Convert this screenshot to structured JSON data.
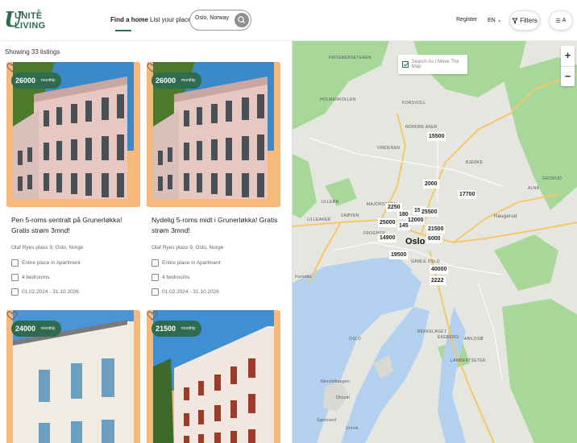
{
  "logo": {
    "line1": "UNITE",
    "line2": "LIVING",
    "mark": "U",
    "registered": "®"
  },
  "nav": {
    "find": "Find a home",
    "list": "List your place"
  },
  "search": {
    "value": "Oslo, Norway",
    "icon": "search-icon"
  },
  "header": {
    "register": "Register",
    "lang": "EN",
    "filters": "Filters",
    "menu_icon": "menu-icon",
    "account": "A"
  },
  "listing": {
    "count_text": "Showing 33 listings",
    "cards": [
      {
        "price": "26000",
        "period": "monthly",
        "title": "Pen 5-roms sentralt på Grunerløkka! Gratis strøm 3mnd!",
        "address": "Olaf Ryes plass 9, Oslo, Norge",
        "type": "Entire place in Apartment",
        "rooms": "4 bedrooms",
        "dates": "01.02.2024 - 31.10.2026"
      },
      {
        "price": "26000",
        "period": "monthly",
        "title": "Nydelig 5-roms midt i Grunerløkka! Gratis strøm 3mnd!",
        "address": "Olaf Ryes plass 9, Oslo, Norge",
        "type": "Entire place in Apartment",
        "rooms": "4 bedrooms",
        "dates": "01.02.2024 - 31.10.2026"
      },
      {
        "price": "24000",
        "period": "monthly"
      },
      {
        "price": "21500",
        "period": "monthly"
      }
    ]
  },
  "map": {
    "toggle_label": "Search As I Move The Map",
    "zoom_in": "+",
    "zoom_out": "−",
    "city": "Oslo",
    "markers": [
      "15500",
      "2000",
      "17700",
      "2250",
      "180",
      "150",
      "25500",
      "12000",
      "25000",
      "145",
      "21500",
      "14900",
      "6000",
      "19500",
      "40000",
      "2222"
    ],
    "places": [
      "FROGNERSETEREN",
      "HOLMENKOLLEN",
      "KORSVOLL",
      "NORDRE AKER",
      "BJERKE",
      "VINDEREN",
      "ULLERN",
      "LILLEAKER",
      "SKØYEN",
      "MAJORSTUEN",
      "FROGNER",
      "GAMLE OSLO",
      "Haugerud",
      "Fornebu",
      "EKEBERG",
      "BEKKELAGET",
      "LAMBERTSETER",
      "ABILDSØ",
      "OSLO",
      "Nesoddtangen",
      "Oksval",
      "Sjøstrand",
      "Ursvik",
      "GRORUD",
      "ALNA"
    ]
  }
}
